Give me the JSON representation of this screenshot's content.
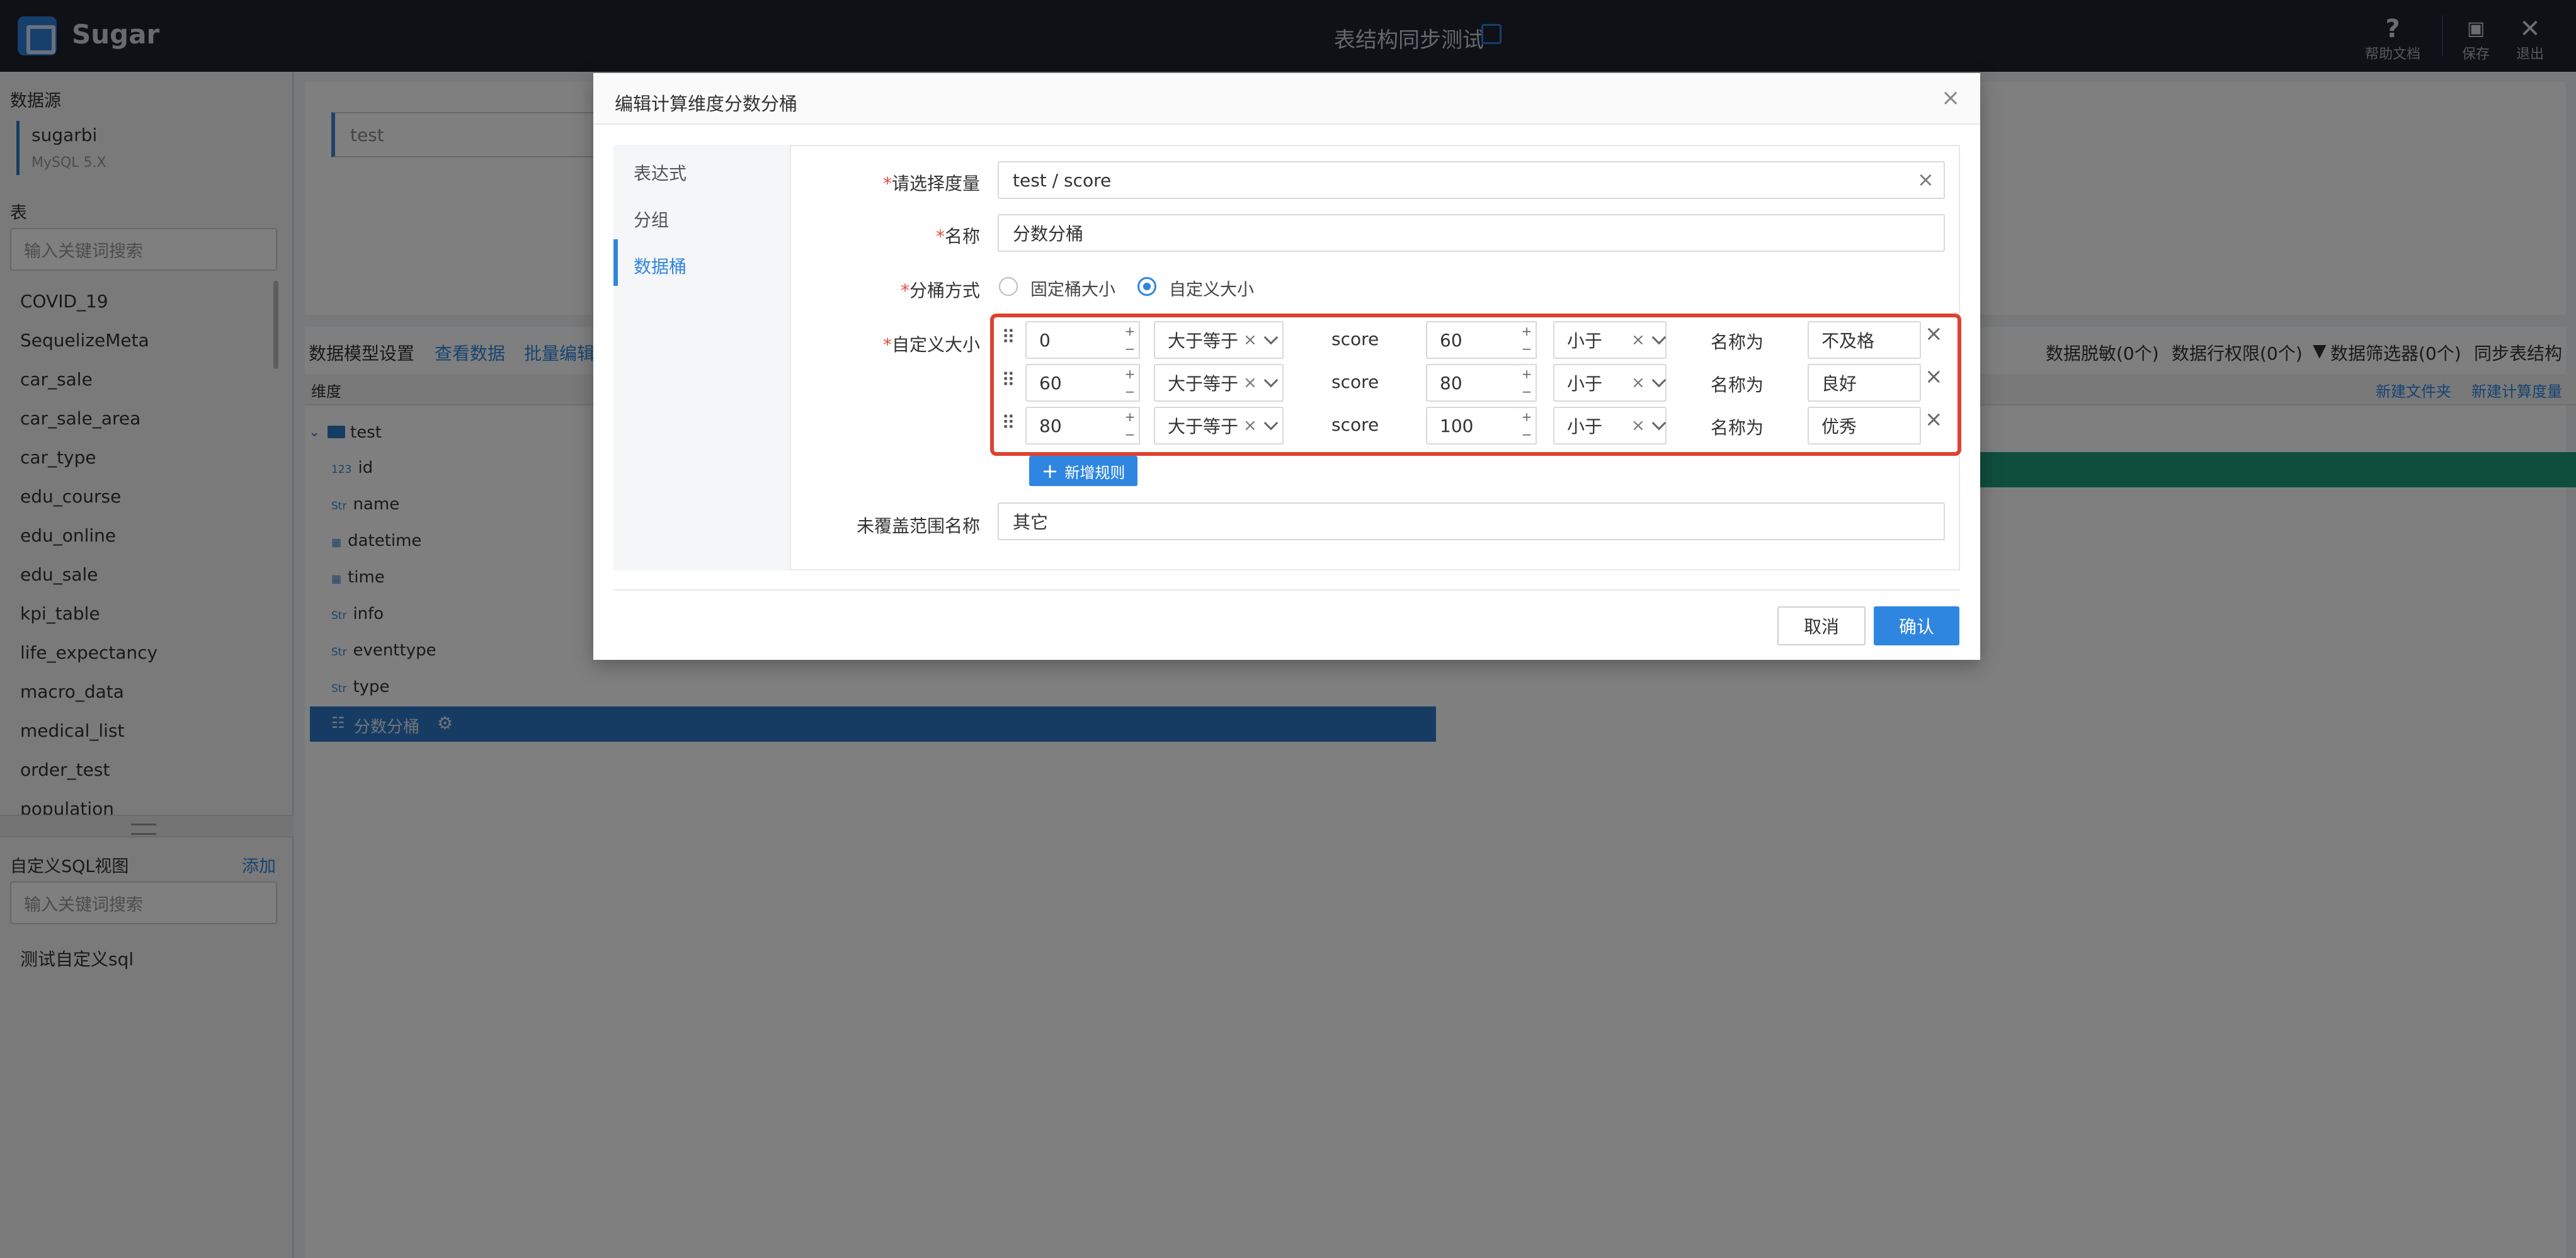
{
  "header": {
    "logo": "Sugar",
    "title": "表结构同步测试",
    "help_label": "帮助文档",
    "save_label": "保存",
    "exit_label": "退出"
  },
  "left_panel": {
    "datasource_title": "数据源",
    "datasource_name": "sugarbi",
    "datasource_type": "MySQL 5.X",
    "table_title": "表",
    "table_search_placeholder": "输入关键词搜索",
    "tables": [
      "COVID_19",
      "SequelizeMeta",
      "car_sale",
      "car_sale_area",
      "car_type",
      "edu_course",
      "edu_online",
      "edu_sale",
      "kpi_table",
      "life_expectancy",
      "macro_data",
      "medical_list",
      "order_test",
      "population"
    ],
    "sql_title": "自定义SQL视图",
    "sql_add": "添加",
    "sql_search_placeholder": "输入关键词搜索",
    "sql_items": [
      "测试自定义sql"
    ]
  },
  "content": {
    "test_input": "test",
    "tabs": [
      "数据模型设置",
      "查看数据",
      "批量编辑"
    ],
    "right_tools": [
      "数据脱敏(0个)",
      "数据行权限(0个)",
      "数据筛选器(0个)",
      "同步表结构"
    ],
    "dim_header": "维度",
    "new_folder": "新建文件夹",
    "new_measure": "新建计算度量",
    "tree_root": "test",
    "fields": [
      {
        "badge": "123",
        "name": "id"
      },
      {
        "badge": "Str",
        "name": "name"
      },
      {
        "badge": "▦",
        "name": "datetime"
      },
      {
        "badge": "▦",
        "name": "time"
      },
      {
        "badge": "Str",
        "name": "info"
      },
      {
        "badge": "Str",
        "name": "eventtype"
      },
      {
        "badge": "Str",
        "name": "type"
      }
    ],
    "selected_field": "分数分桶"
  },
  "modal": {
    "title": "编辑计算维度分数分桶",
    "side_items": [
      "表达式",
      "分组",
      "数据桶"
    ],
    "active_side": "数据桶",
    "measure_label": "请选择度量",
    "measure_value": "test / score",
    "name_label": "名称",
    "name_value": "分数分桶",
    "mode_label": "分桶方式",
    "mode_options": [
      "固定桶大小",
      "自定义大小"
    ],
    "mode_selected": "自定义大小",
    "custom_label": "自定义大小",
    "rules": [
      {
        "lower": "0",
        "lower_op": "大于等于",
        "field": "score",
        "upper": "60",
        "upper_op": "小于",
        "name_label": "名称为",
        "name": "不及格"
      },
      {
        "lower": "60",
        "lower_op": "大于等于",
        "field": "score",
        "upper": "80",
        "upper_op": "小于",
        "name_label": "名称为",
        "name": "良好"
      },
      {
        "lower": "80",
        "lower_op": "大于等于",
        "field": "score",
        "upper": "100",
        "upper_op": "小于",
        "name_label": "名称为",
        "name": "优秀"
      }
    ],
    "add_rule": "新增规则",
    "uncovered_label": "未覆盖范围名称",
    "uncovered_value": "其它",
    "cancel": "取消",
    "confirm": "确认"
  },
  "colors": {
    "header_bg": "#1e232e",
    "accent": "#2f86e0",
    "highlight_border": "#e0412f",
    "green_bar": "#1f9d7a"
  }
}
